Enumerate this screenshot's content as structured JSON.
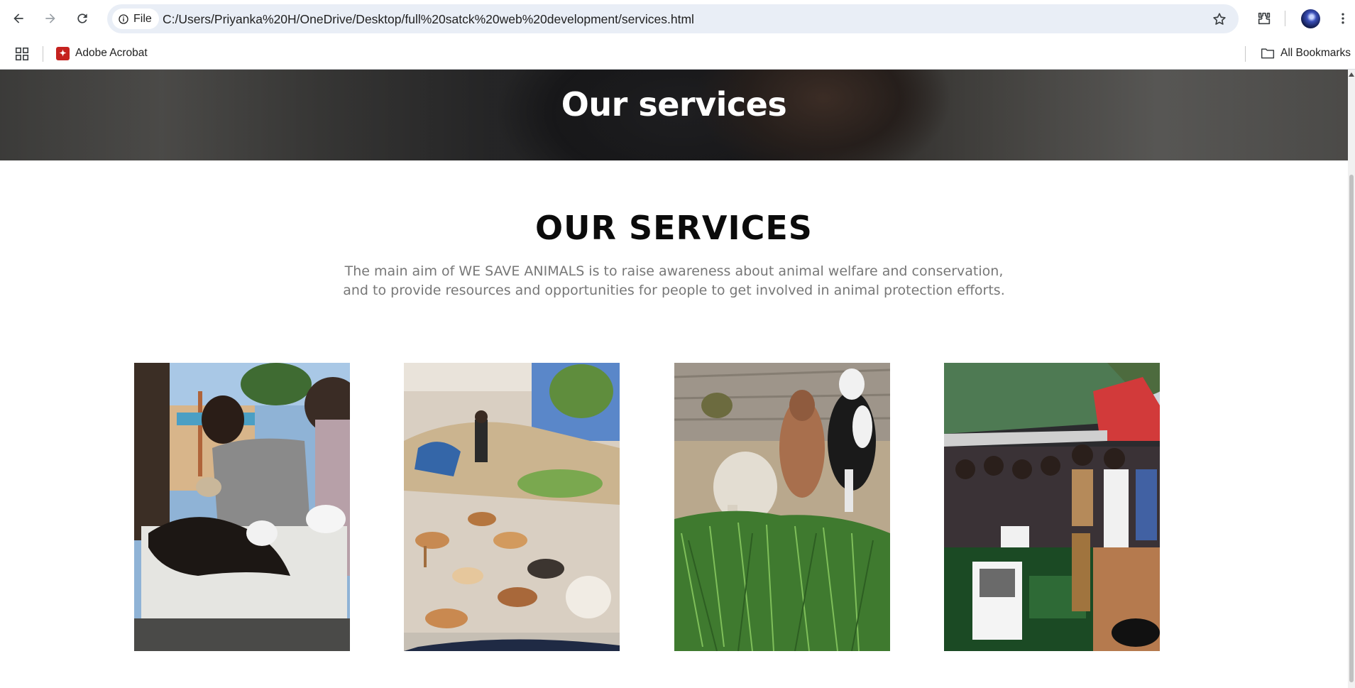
{
  "browser": {
    "site_chip_label": "File",
    "url": "C:/Users/Priyanka%20H/OneDrive/Desktop/full%20satck%20web%20development/services.html",
    "bookmarks": [
      {
        "label": "Adobe Acrobat",
        "icon": "pdf-icon"
      }
    ],
    "all_bookmarks_label": "All Bookmarks"
  },
  "hero": {
    "title": "Our services"
  },
  "services": {
    "heading": "OUR SERVICES",
    "description_line1": "The main aim of WE SAVE ANIMALS is to raise awareness about animal welfare and conservation,",
    "description_line2": "and to provide resources and opportunities for people to get involved in animal protection efforts.",
    "cards": [
      {
        "image": "vet-treating-dog-photo"
      },
      {
        "image": "stray-dogs-feeding-photo"
      },
      {
        "image": "calves-and-sheep-eating-grass-photo"
      },
      {
        "image": "awareness-stall-event-photo"
      }
    ]
  }
}
